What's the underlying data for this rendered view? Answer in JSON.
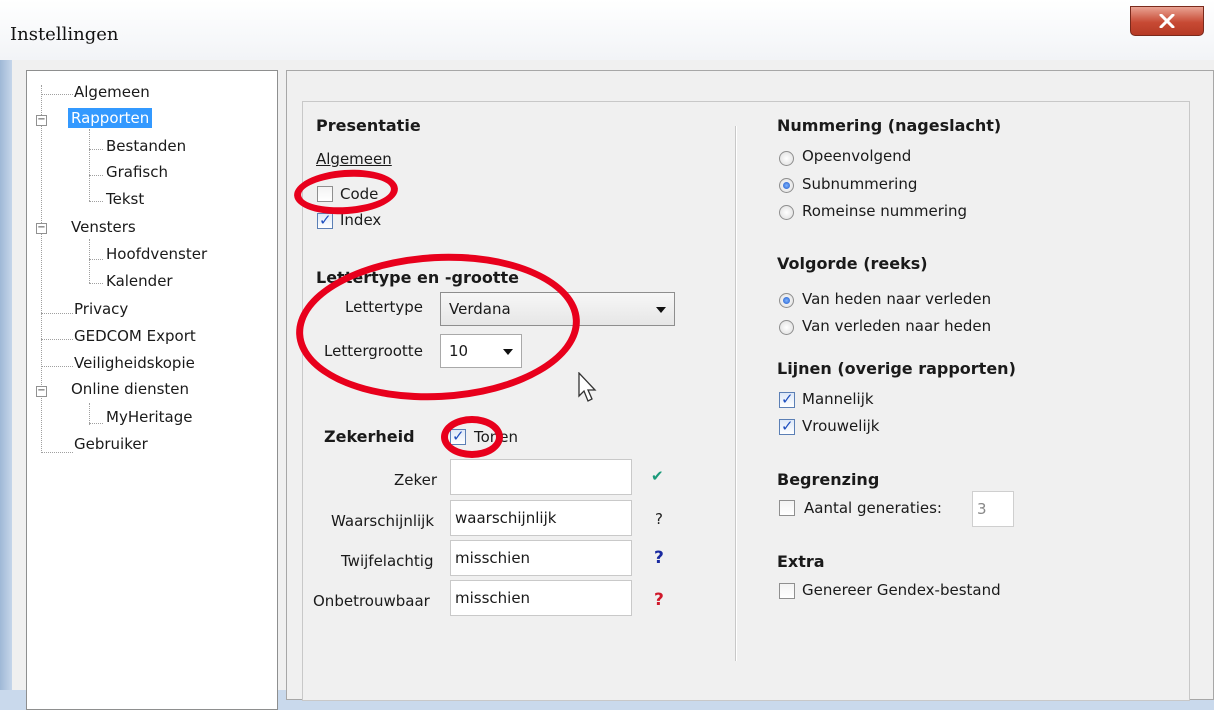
{
  "window": {
    "title": "Instellingen",
    "close_label": "x"
  },
  "tree": {
    "items": [
      {
        "label": "Algemeen"
      },
      {
        "label": "Rapporten"
      },
      {
        "label": "Bestanden"
      },
      {
        "label": "Grafisch"
      },
      {
        "label": "Tekst"
      },
      {
        "label": "Vensters"
      },
      {
        "label": "Hoofdvenster"
      },
      {
        "label": "Kalender"
      },
      {
        "label": "Privacy"
      },
      {
        "label": "GEDCOM Export"
      },
      {
        "label": "Veiligheidskopie"
      },
      {
        "label": "Online diensten"
      },
      {
        "label": "MyHeritage"
      },
      {
        "label": "Gebruiker"
      }
    ],
    "selected": "Rapporten"
  },
  "presentatie": {
    "heading": "Presentatie",
    "algemeen_label": "Algemeen",
    "code": {
      "label": "Code",
      "checked": false
    },
    "index": {
      "label": "Index",
      "checked": true
    }
  },
  "lettertype": {
    "heading": "Lettertype en -grootte",
    "font_label": "Lettertype",
    "font_value": "Verdana",
    "size_label": "Lettergrootte",
    "size_value": "10"
  },
  "zekerheid": {
    "heading": "Zekerheid",
    "tonen": {
      "label": "Tonen",
      "checked": true
    },
    "rows": [
      {
        "label": "Zeker",
        "value": "",
        "mark": "✔",
        "mark_color": "#1a9a7a"
      },
      {
        "label": "Waarschijnlijk",
        "value": "waarschijnlijk",
        "mark": "?",
        "mark_color": "#222222"
      },
      {
        "label": "Twijfelachtig",
        "value": "misschien",
        "mark": "?",
        "mark_color": "#1a2aa0"
      },
      {
        "label": "Onbetrouwbaar",
        "value": "misschien",
        "mark": "?",
        "mark_color": "#d0192b"
      }
    ]
  },
  "nummering": {
    "heading": "Nummering (nageslacht)",
    "options": [
      "Opeenvolgend",
      "Subnummering",
      "Romeinse nummering"
    ],
    "selected": "Subnummering"
  },
  "volgorde": {
    "heading": "Volgorde (reeks)",
    "options": [
      "Van heden naar verleden",
      "Van verleden naar heden"
    ],
    "selected": "Van heden naar verleden"
  },
  "lijnen": {
    "heading": "Lijnen (overige rapporten)",
    "mannelijk": {
      "label": "Mannelijk",
      "checked": true
    },
    "vrouwelijk": {
      "label": "Vrouwelijk",
      "checked": true
    }
  },
  "begrenzing": {
    "heading": "Begrenzing",
    "aantal": {
      "label": "Aantal generaties:",
      "checked": false,
      "value": "3"
    }
  },
  "extra": {
    "heading": "Extra",
    "gendex": {
      "label": "Genereer Gendex-bestand",
      "checked": false
    }
  },
  "colors": {
    "annotation": "#e8001c",
    "selection": "#3399ff"
  }
}
